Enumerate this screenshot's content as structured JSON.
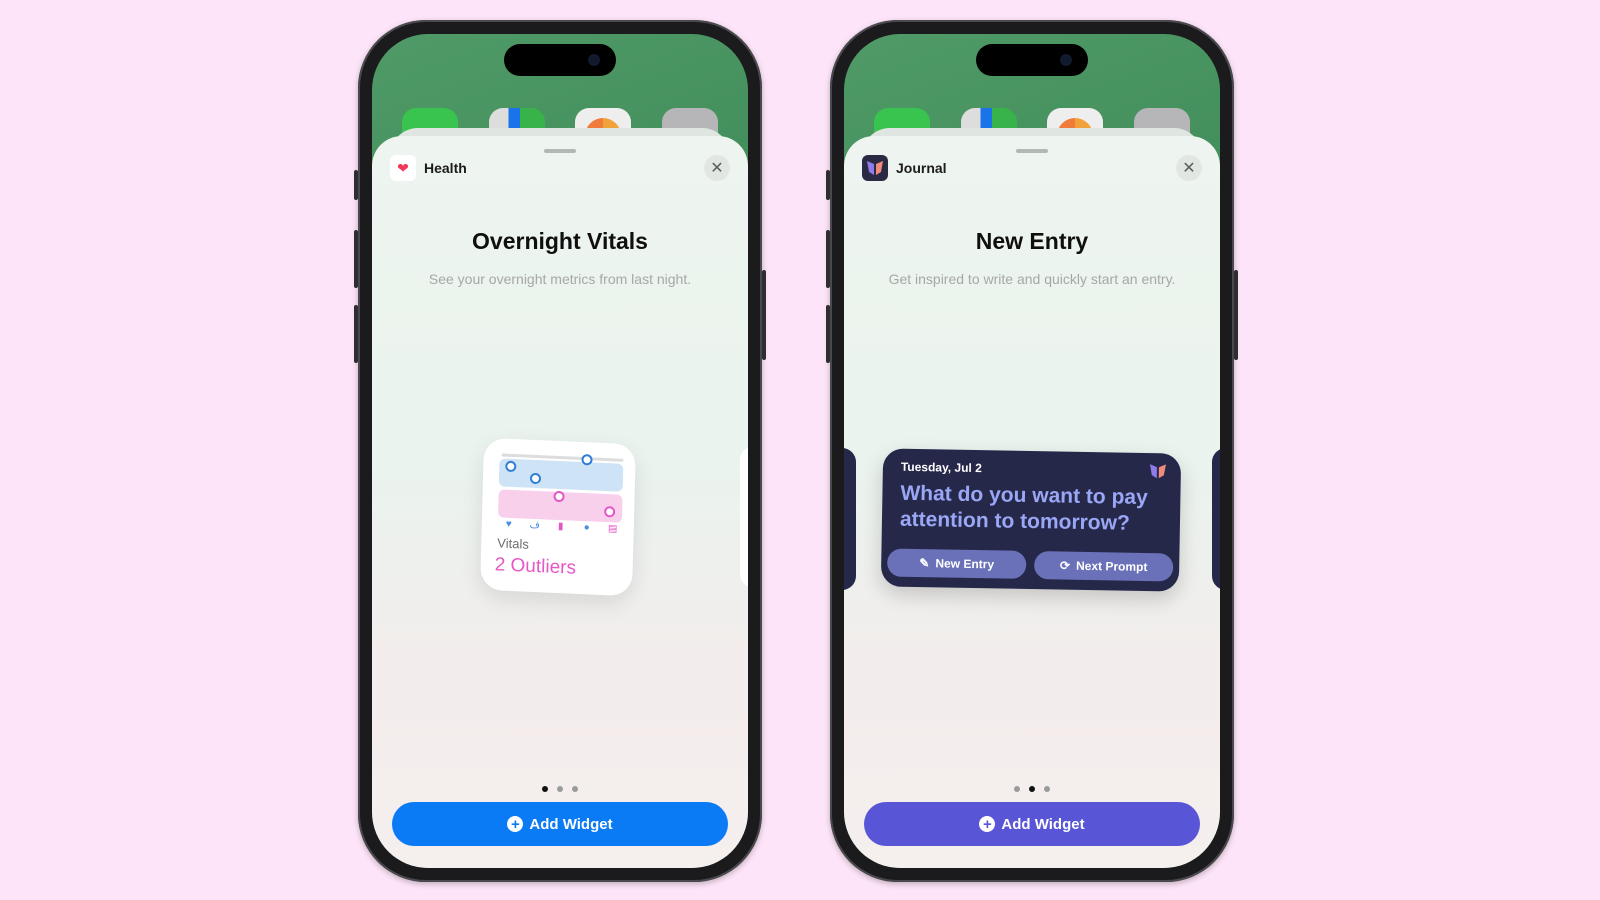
{
  "left_phone": {
    "home_apps": [
      "Messages",
      "Maps",
      "Photos",
      "Camera"
    ],
    "header": {
      "app_icon": "heart-icon",
      "app_name": "Health",
      "close_icon": "close-icon"
    },
    "widget": {
      "title": "Overnight Vitals",
      "description": "See your overnight metrics from last night.",
      "preview": {
        "label": "Vitals",
        "value": "2 Outliers",
        "metric_icons": [
          "heart-icon",
          "lungs-icon",
          "thermometer-icon",
          "oxygen-icon",
          "bed-icon"
        ],
        "value_color": "#e657c7"
      }
    },
    "pagination": {
      "total": 3,
      "active_index": 0
    },
    "add_button": {
      "label": "Add Widget",
      "icon": "plus-circle-icon",
      "color": "#0a7bf5"
    }
  },
  "right_phone": {
    "home_apps": [
      "Messages",
      "Maps",
      "Photos",
      "Camera"
    ],
    "header": {
      "app_icon": "journal-butterfly-icon",
      "app_name": "Journal",
      "close_icon": "close-icon"
    },
    "widget": {
      "title": "New Entry",
      "description": "Get inspired to write and quickly start an entry.",
      "preview": {
        "date": "Tuesday, Jul 2",
        "prompt": "What do you want to pay attention to tomorrow?",
        "buttons": [
          {
            "label": "New Entry",
            "icon": "compose-icon"
          },
          {
            "label": "Next Prompt",
            "icon": "refresh-icon"
          }
        ]
      }
    },
    "pagination": {
      "total": 3,
      "active_index": 1
    },
    "add_button": {
      "label": "Add Widget",
      "icon": "plus-circle-icon",
      "color": "#5856d6"
    }
  },
  "background_color": "#fde4f8"
}
